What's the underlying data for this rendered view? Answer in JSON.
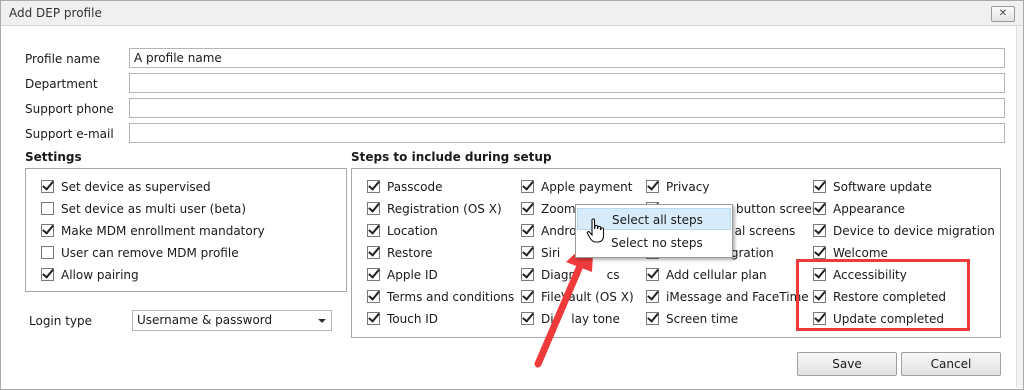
{
  "window": {
    "title": "Add DEP profile",
    "close_label": "✕"
  },
  "fields": [
    {
      "label": "Profile name",
      "value": "A profile name"
    },
    {
      "label": "Department",
      "value": ""
    },
    {
      "label": "Support phone",
      "value": ""
    },
    {
      "label": "Support e-mail",
      "value": ""
    }
  ],
  "settings": {
    "title": "Settings",
    "items": [
      {
        "label": "Set device as supervised",
        "checked": true
      },
      {
        "label": "Set device as multi user (beta)",
        "checked": false
      },
      {
        "label": "Make MDM enrollment mandatory",
        "checked": true
      },
      {
        "label": "User can remove MDM profile",
        "checked": false
      },
      {
        "label": "Allow pairing",
        "checked": true
      }
    ]
  },
  "login": {
    "label": "Login type",
    "value": "Username & password"
  },
  "steps": {
    "title": "Steps to include during setup",
    "col1": [
      {
        "label": "Passcode",
        "checked": true
      },
      {
        "label": "Registration (OS X)",
        "checked": true
      },
      {
        "label": "Location",
        "checked": true
      },
      {
        "label": "Restore",
        "checked": true
      },
      {
        "label": "Apple ID",
        "checked": true
      },
      {
        "label": "Terms and conditions",
        "checked": true
      },
      {
        "label": "Touch ID",
        "checked": true
      }
    ],
    "col2": [
      {
        "label": "Apple payment",
        "checked": true
      },
      {
        "label": "Zoom",
        "checked": true
      },
      {
        "label": "Androi",
        "checked": true
      },
      {
        "label": "Siri",
        "checked": true
      },
      {
        "label": "Diagn        cs",
        "checked": true
      },
      {
        "label": "FileVault (OS X)",
        "checked": true
      },
      {
        "label": "Dis   lay tone",
        "checked": true
      }
    ],
    "col3": [
      {
        "label": "Privacy",
        "checked": true
      },
      {
        "label": "H                button screen",
        "checked": true
      },
      {
        "label": "                  al screens",
        "checked": true
      },
      {
        "label": "                 gration",
        "checked": true
      },
      {
        "label": "Add cellular plan",
        "checked": true
      },
      {
        "label": "iMessage and FaceTime",
        "checked": true
      },
      {
        "label": "Screen time",
        "checked": true
      }
    ],
    "col4": [
      {
        "label": "Software update",
        "checked": true
      },
      {
        "label": "Appearance",
        "checked": true
      },
      {
        "label": "Device to device migration",
        "checked": true
      },
      {
        "label": "Welcome",
        "checked": true
      },
      {
        "label": "Accessibility",
        "checked": true
      },
      {
        "label": "Restore completed",
        "checked": true
      },
      {
        "label": "Update completed",
        "checked": true
      }
    ]
  },
  "context_menu": {
    "select_all": "Select all steps",
    "select_none": "Select no steps"
  },
  "buttons": {
    "save": "Save",
    "cancel": "Cancel"
  },
  "colors": {
    "highlight": "#ee3a3a",
    "menu_hover": "#d7ebfa"
  }
}
